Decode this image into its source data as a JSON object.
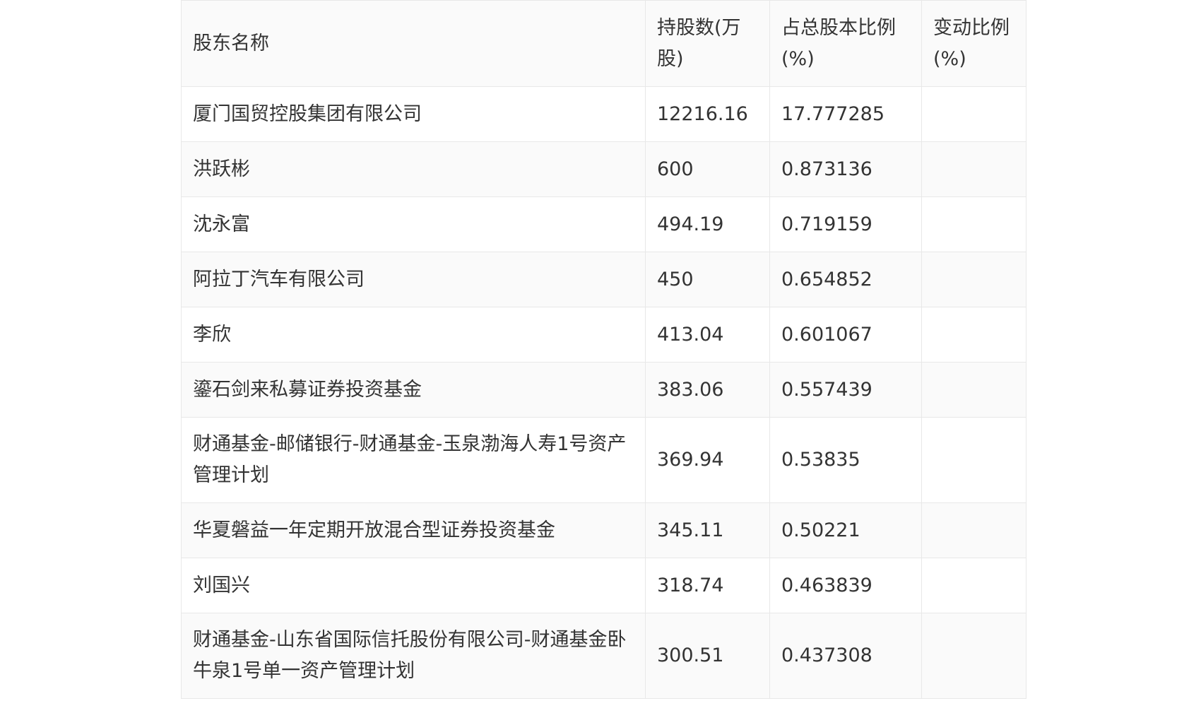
{
  "table": {
    "headers": [
      "股东名称",
      "持股数(万股)",
      "占总股本比例(%)",
      "变动比例(%)"
    ],
    "rows": [
      {
        "name": "厦门国贸控股集团有限公司",
        "shares": "12216.16",
        "ratio": "17.777285",
        "change": ""
      },
      {
        "name": "洪跃彬",
        "shares": "600",
        "ratio": "0.873136",
        "change": ""
      },
      {
        "name": "沈永富",
        "shares": "494.19",
        "ratio": "0.719159",
        "change": ""
      },
      {
        "name": "阿拉丁汽车有限公司",
        "shares": "450",
        "ratio": "0.654852",
        "change": ""
      },
      {
        "name": "李欣",
        "shares": "413.04",
        "ratio": "0.601067",
        "change": ""
      },
      {
        "name": "鎏石剑来私募证券投资基金",
        "shares": "383.06",
        "ratio": "0.557439",
        "change": ""
      },
      {
        "name": "财通基金-邮储银行-财通基金-玉泉渤海人寿1号资产管理计划",
        "shares": "369.94",
        "ratio": "0.53835",
        "change": ""
      },
      {
        "name": "华夏磐益一年定期开放混合型证券投资基金",
        "shares": "345.11",
        "ratio": "0.50221",
        "change": ""
      },
      {
        "name": "刘国兴",
        "shares": "318.74",
        "ratio": "0.463839",
        "change": ""
      },
      {
        "name": "财通基金-山东省国际信托股份有限公司-财通基金卧牛泉1号单一资产管理计划",
        "shares": "300.51",
        "ratio": "0.437308",
        "change": ""
      }
    ]
  }
}
